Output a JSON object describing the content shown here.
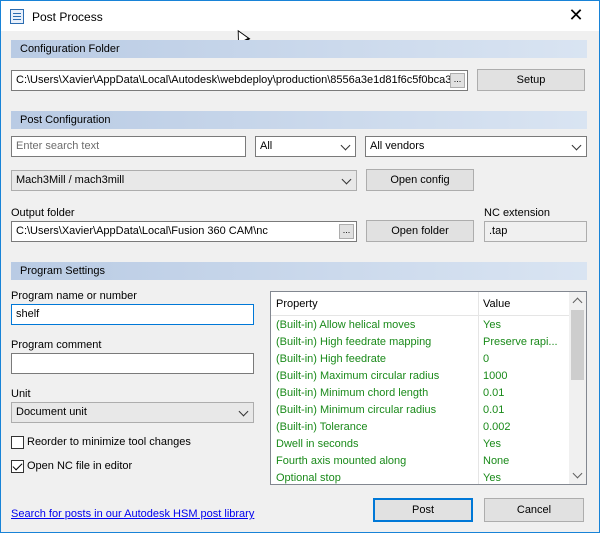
{
  "window": {
    "title": "Post Process"
  },
  "config_folder": {
    "header": "Configuration Folder",
    "path": "C:\\Users\\Xavier\\AppData\\Local\\Autodesk\\webdeploy\\production\\8556a3e1d81f6c5f0bca3",
    "browse_label": "...",
    "setup_label": "Setup"
  },
  "post_config": {
    "header": "Post Configuration",
    "search_placeholder": "Enter search text",
    "filter_value": "All",
    "vendor_value": "All vendors",
    "post_value": "Mach3Mill / mach3mill",
    "open_config_label": "Open config",
    "output_folder_label": "Output folder",
    "output_folder_path": "C:\\Users\\Xavier\\AppData\\Local\\Fusion 360 CAM\\nc",
    "open_folder_label": "Open folder",
    "nc_extension_label": "NC extension",
    "nc_extension_value": ".tap"
  },
  "program_settings": {
    "header": "Program Settings",
    "program_name_label": "Program name or number",
    "program_name_value": "shelf",
    "program_comment_label": "Program comment",
    "program_comment_value": "",
    "unit_label": "Unit",
    "unit_value": "Document unit",
    "reorder_label": "Reorder to minimize tool changes",
    "reorder_checked": false,
    "open_nc_label": "Open NC file in editor",
    "open_nc_checked": true
  },
  "properties": {
    "col_property": "Property",
    "col_value": "Value",
    "rows": [
      {
        "property": "(Built-in) Allow helical moves",
        "value": "Yes"
      },
      {
        "property": "(Built-in) High feedrate mapping",
        "value": "Preserve rapi..."
      },
      {
        "property": "(Built-in) High feedrate",
        "value": "0"
      },
      {
        "property": "(Built-in) Maximum circular radius",
        "value": "1000"
      },
      {
        "property": "(Built-in) Minimum chord length",
        "value": "0.01"
      },
      {
        "property": "(Built-in) Minimum circular radius",
        "value": "0.01"
      },
      {
        "property": "(Built-in) Tolerance",
        "value": "0.002"
      },
      {
        "property": "Dwell in seconds",
        "value": "Yes"
      },
      {
        "property": "Fourth axis mounted along",
        "value": "None"
      },
      {
        "property": "Optional stop",
        "value": "Yes"
      }
    ]
  },
  "footer": {
    "library_link": "Search for posts in our Autodesk HSM post library",
    "post_label": "Post",
    "cancel_label": "Cancel"
  },
  "colors": {
    "accent": "#0078d7",
    "property_text": "#1a8a1a",
    "link": "#0000ee"
  }
}
